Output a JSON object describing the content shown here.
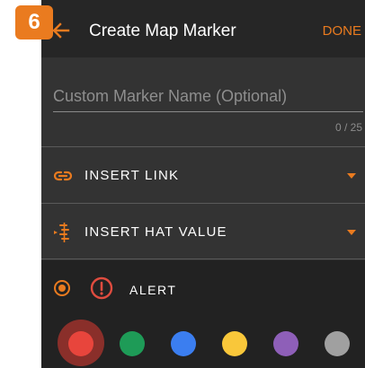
{
  "step_badge": "6",
  "header": {
    "title": "Create Map Marker",
    "done_label": "DONE",
    "back_icon": "arrow-left-icon"
  },
  "name_field": {
    "placeholder": "Custom Marker Name (Optional)",
    "value": "",
    "char_count": "0 / 25"
  },
  "options": [
    {
      "label": "INSERT LINK",
      "icon": "link-icon"
    },
    {
      "label": "INSERT HAT VALUE",
      "icon": "hat-value-icon"
    }
  ],
  "marker_type": {
    "label": "ALERT",
    "icon": "alert-exclamation-icon",
    "selected": true
  },
  "colors": {
    "accent": "#ea7b1f",
    "swatches": [
      "#e8453c",
      "#1e9b57",
      "#3b7ef0",
      "#f9c73a",
      "#8e5fb8",
      "#a0a0a0"
    ],
    "selected_swatch": "#e8453c"
  }
}
